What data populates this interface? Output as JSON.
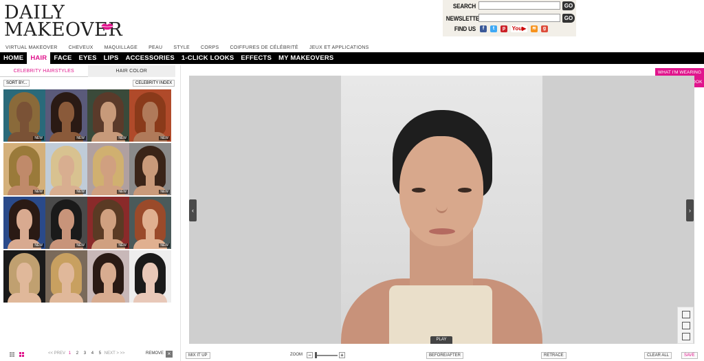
{
  "logo": {
    "line1": "DAILY",
    "line2": "MAKEOVER"
  },
  "header_form": {
    "search_label": "SEARCH",
    "newsletter_label": "NEWSLETTER",
    "go_label": "GO",
    "findus_label": "FIND US"
  },
  "subnav": [
    "VIRTUAL MAKEOVER",
    "CHEVEUX",
    "MAQUILLAGE",
    "PEAU",
    "STYLE",
    "CORPS",
    "COIFFURES DE CÉLÉBRITÉ",
    "JEUX ET APPLICATIONS"
  ],
  "mainnav": [
    "HOME",
    "HAIR",
    "FACE",
    "EYES",
    "LIPS",
    "ACCESSORIES",
    "1-CLICK LOOKS",
    "EFFECTS",
    "MY MAKEOVERS"
  ],
  "active_nav": "HAIR",
  "left_tabs": {
    "celebrity": "CELEBRITY HAIRSTYLES",
    "color": "HAIR COLOR"
  },
  "sort_label": "SORT BY...",
  "celebrity_index_label": "CELEBRITY INDEX",
  "new_badge": "NEW",
  "pager": {
    "prev": "<< PREV",
    "pages": [
      "1",
      "2",
      "3",
      "4",
      "5"
    ],
    "current": "1",
    "next": "NEXT >",
    "last": ">>"
  },
  "remove_label": "REMOVE",
  "right_tabs": {
    "wearing": "WHAT I'M WEARING",
    "share": "+ SHARE THIS LOOK"
  },
  "play_label": "PLAY",
  "bottom": {
    "mix": "MIX IT UP",
    "zoom": "ZOOM",
    "before_after": "BEFORE/AFTER",
    "retrace": "RETRACE",
    "clear_all": "CLEAR ALL",
    "save": "SAVE"
  },
  "colors": {
    "accent": "#e0148c",
    "nav_bg": "#000000"
  }
}
